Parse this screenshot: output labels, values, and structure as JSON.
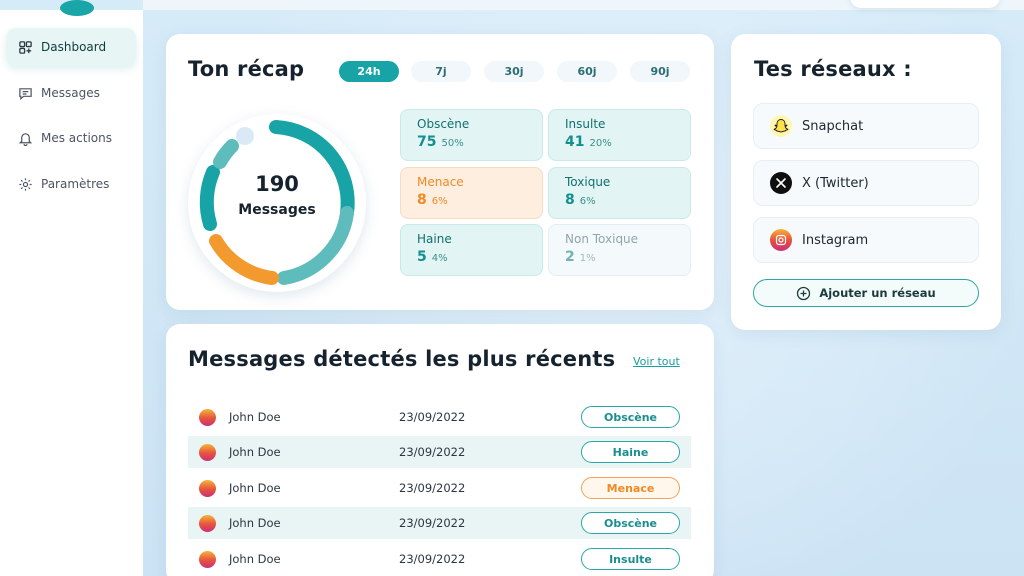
{
  "sidebar": {
    "items": [
      {
        "label": "Dashboard",
        "icon": "grid-icon",
        "active": true
      },
      {
        "label": "Messages",
        "icon": "chat-icon"
      },
      {
        "label": "Mes actions",
        "icon": "bell-icon"
      },
      {
        "label": "Paramètres",
        "icon": "gear-icon"
      }
    ]
  },
  "recap": {
    "title": "Ton récap",
    "tabs": [
      "24h",
      "7j",
      "30j",
      "60j",
      "90j"
    ],
    "active_tab": "24h",
    "total_count": "190",
    "total_label": "Messages",
    "stats": [
      {
        "name": "Obscène",
        "value": "75",
        "percent": "50%",
        "tone": "teal"
      },
      {
        "name": "Insulte",
        "value": "41",
        "percent": "20%",
        "tone": "teal"
      },
      {
        "name": "Menace",
        "value": "8",
        "percent": "6%",
        "tone": "orange"
      },
      {
        "name": "Toxique",
        "value": "8",
        "percent": "6%",
        "tone": "teal"
      },
      {
        "name": "Haine",
        "value": "5",
        "percent": "4%",
        "tone": "teal"
      },
      {
        "name": "Non Toxique",
        "value": "2",
        "percent": "1%",
        "tone": "light"
      }
    ],
    "colors": {
      "accent": "#18a3a6",
      "orange": "#f39a2e",
      "light_teal": "#5fbcbc",
      "pale_blue": "#dbe9f7"
    }
  },
  "networks": {
    "title": "Tes réseaux :",
    "items": [
      {
        "label": "Snapchat",
        "icon": "snapchat-icon"
      },
      {
        "label": "X (Twitter)",
        "icon": "x-icon"
      },
      {
        "label": "Instagram",
        "icon": "instagram-icon"
      }
    ],
    "add_label": "Ajouter un réseau"
  },
  "messages": {
    "title": "Messages détectés les plus récents",
    "see_all": "Voir tout",
    "rows": [
      {
        "name": "John Doe",
        "date": "23/09/2022",
        "tag": "Obscène",
        "tone": "teal"
      },
      {
        "name": "John Doe",
        "date": "23/09/2022",
        "tag": "Haine",
        "tone": "teal"
      },
      {
        "name": "John Doe",
        "date": "23/09/2022",
        "tag": "Menace",
        "tone": "orange"
      },
      {
        "name": "John Doe",
        "date": "23/09/2022",
        "tag": "Obscène",
        "tone": "teal"
      },
      {
        "name": "John Doe",
        "date": "23/09/2022",
        "tag": "Insulte",
        "tone": "teal"
      }
    ]
  }
}
